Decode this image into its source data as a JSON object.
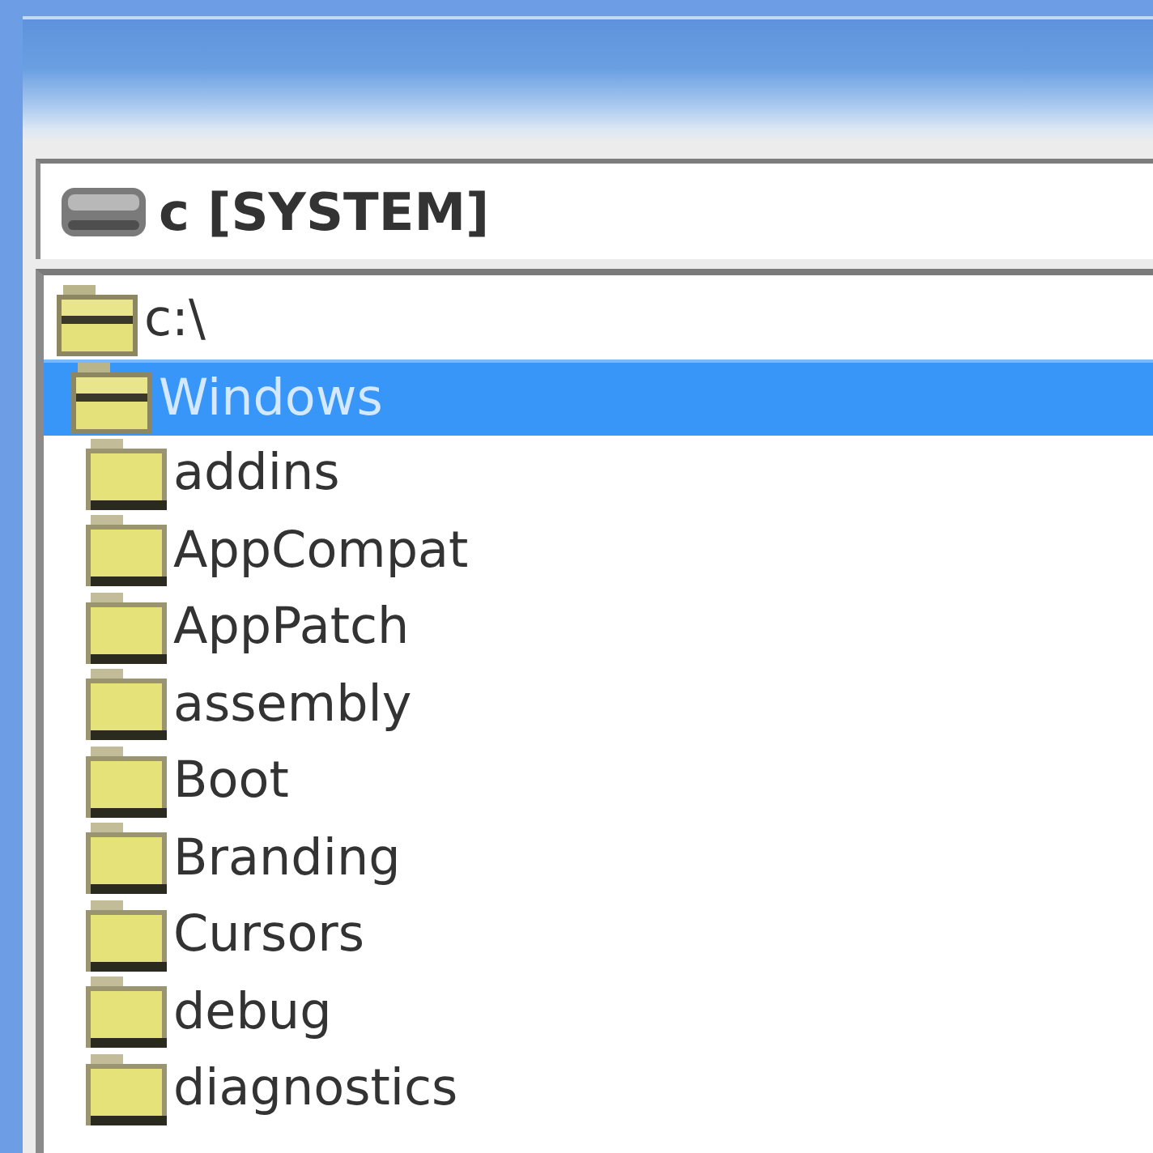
{
  "drive_selector": {
    "label": "c [SYSTEM]"
  },
  "folder_tree": {
    "items": [
      {
        "name": "c:\\",
        "expanded": true,
        "selected": false,
        "children": [
          {
            "name": "Windows",
            "expanded": true,
            "selected": true,
            "children": [
              {
                "name": "addins",
                "expanded": false,
                "selected": false
              },
              {
                "name": "AppCompat",
                "expanded": false,
                "selected": false
              },
              {
                "name": "AppPatch",
                "expanded": false,
                "selected": false
              },
              {
                "name": "assembly",
                "expanded": false,
                "selected": false
              },
              {
                "name": "Boot",
                "expanded": false,
                "selected": false
              },
              {
                "name": "Branding",
                "expanded": false,
                "selected": false
              },
              {
                "name": "Cursors",
                "expanded": false,
                "selected": false
              },
              {
                "name": "debug",
                "expanded": false,
                "selected": false
              },
              {
                "name": "diagnostics",
                "expanded": false,
                "selected": false
              }
            ]
          }
        ]
      }
    ]
  }
}
